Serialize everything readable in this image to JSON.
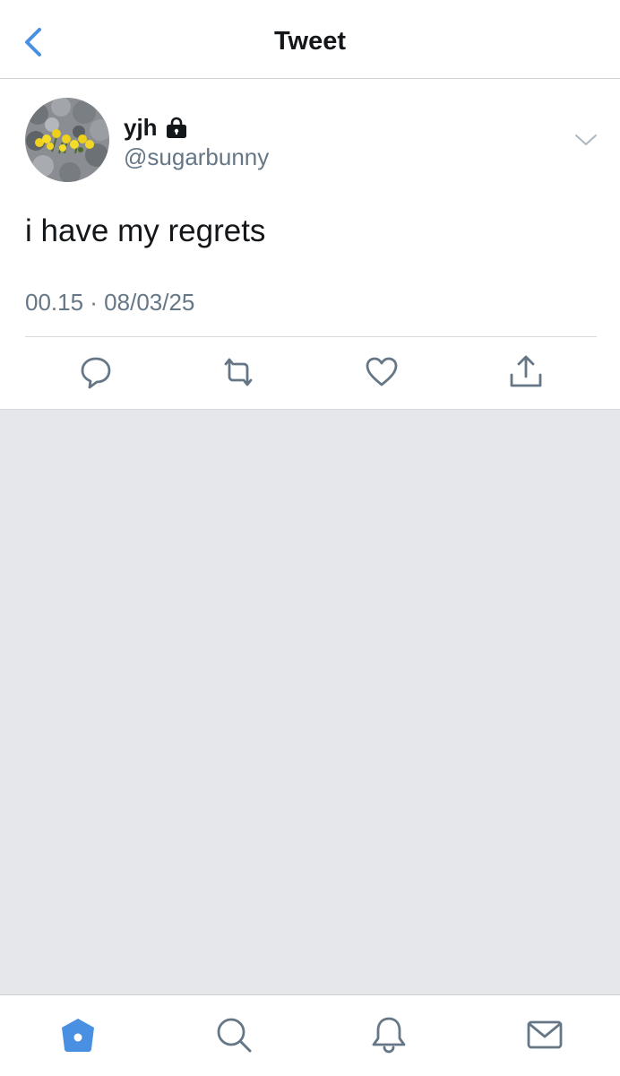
{
  "header": {
    "title": "Tweet",
    "back_icon": "chevron-left-icon"
  },
  "tweet": {
    "author": {
      "display_name": "yjh",
      "handle": "@sugarbunny",
      "protected": true,
      "avatar": "daffodils-among-rocks-avatar"
    },
    "text": "i have my regrets",
    "timestamp": "00.15 · 08/03/25",
    "actions": [
      "reply-icon",
      "retweet-icon",
      "like-icon",
      "share-icon"
    ]
  },
  "tabbar": {
    "items": [
      "home-icon",
      "search-icon",
      "notifications-icon",
      "messages-icon"
    ],
    "active": "home-icon"
  },
  "colors": {
    "accent": "#4a90e2",
    "text_primary": "#14171a",
    "text_secondary": "#657786",
    "icon_gray": "#657786",
    "empty_background": "#e6e7eb"
  }
}
